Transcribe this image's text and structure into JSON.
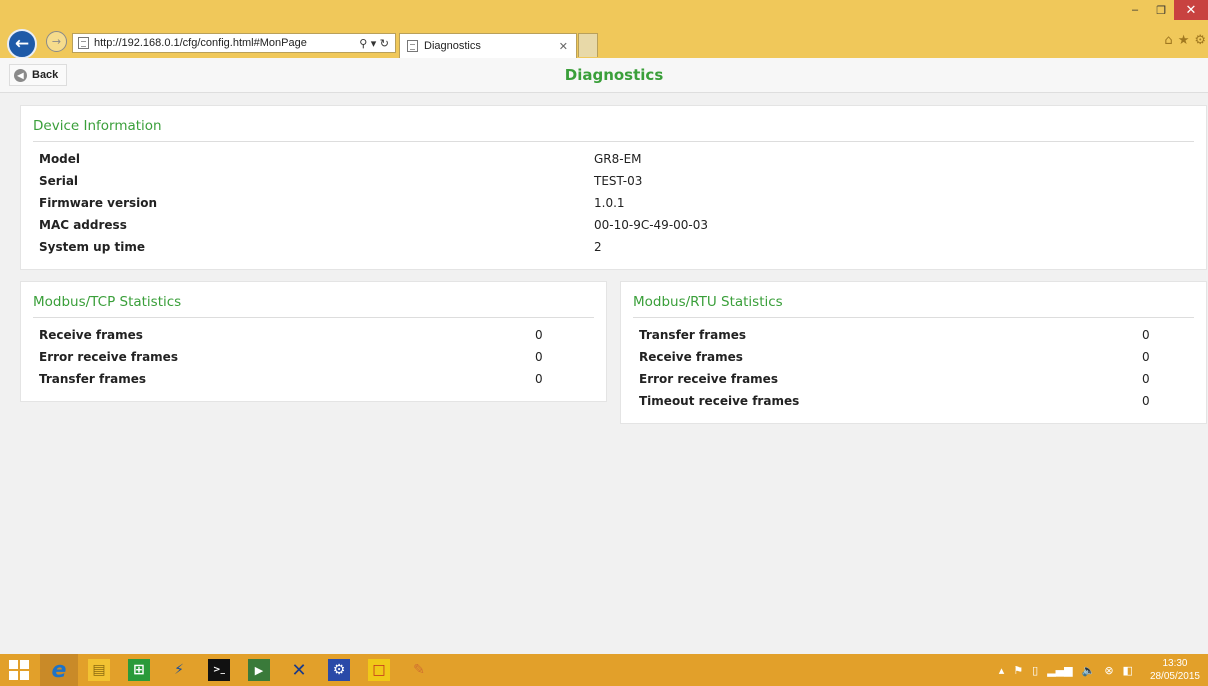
{
  "browser": {
    "url": "http://192.168.0.1/cfg/config.html#MonPage",
    "tab_title": "Diagnostics",
    "window_controls": {
      "minimize": "–",
      "restore": "❐",
      "close": "✕"
    },
    "addr_tools": "⚲ ▾ ↻",
    "tab_close": "✕",
    "fav_icons": [
      "home-icon",
      "favorites-star-icon",
      "settings-gear-icon"
    ]
  },
  "page": {
    "back_label": "Back",
    "title": "Diagnostics"
  },
  "device_info": {
    "heading": "Device Information",
    "rows": [
      {
        "label": "Model",
        "value": "GR8-EM"
      },
      {
        "label": "Serial",
        "value": "TEST-03"
      },
      {
        "label": "Firmware version",
        "value": "1.0.1"
      },
      {
        "label": "MAC address",
        "value": "00-10-9C-49-00-03"
      },
      {
        "label": "System up time",
        "value": "2"
      }
    ]
  },
  "tcp_stats": {
    "heading": "Modbus/TCP Statistics",
    "rows": [
      {
        "label": "Receive frames",
        "value": "0"
      },
      {
        "label": "Error receive frames",
        "value": "0"
      },
      {
        "label": "Transfer frames",
        "value": "0"
      }
    ]
  },
  "rtu_stats": {
    "heading": "Modbus/RTU Statistics",
    "rows": [
      {
        "label": "Transfer frames",
        "value": "0"
      },
      {
        "label": "Receive frames",
        "value": "0"
      },
      {
        "label": "Error receive frames",
        "value": "0"
      },
      {
        "label": "Timeout receive frames",
        "value": "0"
      }
    ]
  },
  "taskbar": {
    "items": [
      {
        "icon": "internet-explorer-icon",
        "color": "#1e73c8",
        "glyph": "e"
      },
      {
        "icon": "file-explorer-icon",
        "color": "#f2c232",
        "glyph": "▤"
      },
      {
        "icon": "store-icon",
        "color": "#2a9a3a",
        "glyph": "⊞"
      },
      {
        "icon": "labview-icon",
        "color": "#1a4f9a",
        "glyph": "⚡"
      },
      {
        "icon": "command-prompt-icon",
        "color": "#111111",
        "glyph": ">_"
      },
      {
        "icon": "media-player-icon",
        "color": "#3a7a3a",
        "glyph": "▶"
      },
      {
        "icon": "ni-max-icon",
        "color": "#1a3a8a",
        "glyph": "✕"
      },
      {
        "icon": "settings-icon",
        "color": "#2a4aa8",
        "glyph": "⚙"
      },
      {
        "icon": "sticky-notes-icon",
        "color": "#f0c818",
        "glyph": "□"
      },
      {
        "icon": "paint-icon",
        "color": "#d07030",
        "glyph": "✎"
      }
    ],
    "clock_time": "13:30",
    "clock_date": "28/05/2015",
    "tray_icons": [
      "tray-arrow-icon",
      "flag-icon",
      "battery-icon",
      "signal-icon",
      "volume-icon",
      "close-circle-icon",
      "device-icon"
    ]
  },
  "colors": {
    "accent_green": "#3a9f3a",
    "chrome_yellow": "#f0c85a",
    "taskbar_orange": "#e2a02a",
    "close_red": "#c84240"
  }
}
